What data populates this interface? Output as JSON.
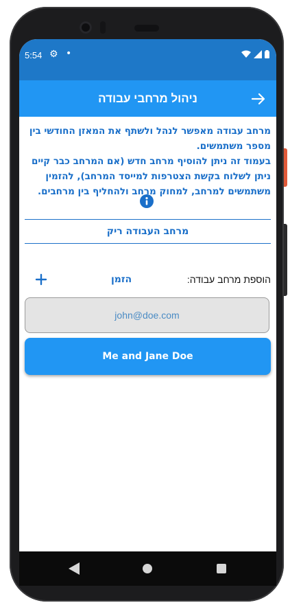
{
  "status_bar": {
    "time": "5:54",
    "icons": [
      "gear-icon",
      "notification-dot-icon",
      "wifi-icon",
      "signal-icon",
      "battery-icon"
    ],
    "background_color": "#1e78c8"
  },
  "app_bar": {
    "title": "ניהול מרחבי עבודה",
    "back_icon": "arrow-right-icon",
    "background_color": "#2196f3"
  },
  "description": {
    "paragraph_1": "מרחב עבודה מאפשר לנהל ולשתף את המאזן החודשי בין מספר משתמשים.",
    "paragraph_2": "בעמוד זה ניתן להוסיף מרחב חדש (אם המרחב כבר קיים ניתן לשלוח בקשת הצטרפות למייסד המרחב), להזמין משתמשים למרחב, למחוק מרחב ולהחליף בין מרחבים.",
    "info_icon": "info-icon",
    "text_color": "#1a6fc9"
  },
  "workspace_section": {
    "empty_label": "מרחב העבודה ריק"
  },
  "add_workspace": {
    "label": "הוספת מרחב עבודה:",
    "invite_label": "הזמן",
    "add_icon": "plus-icon",
    "email_placeholder": "john@doe.com",
    "workspace_button_label": "Me and Jane Doe"
  },
  "nav_bar": {
    "icons": [
      "back-triangle-icon",
      "home-circle-icon",
      "recents-square-icon"
    ]
  }
}
